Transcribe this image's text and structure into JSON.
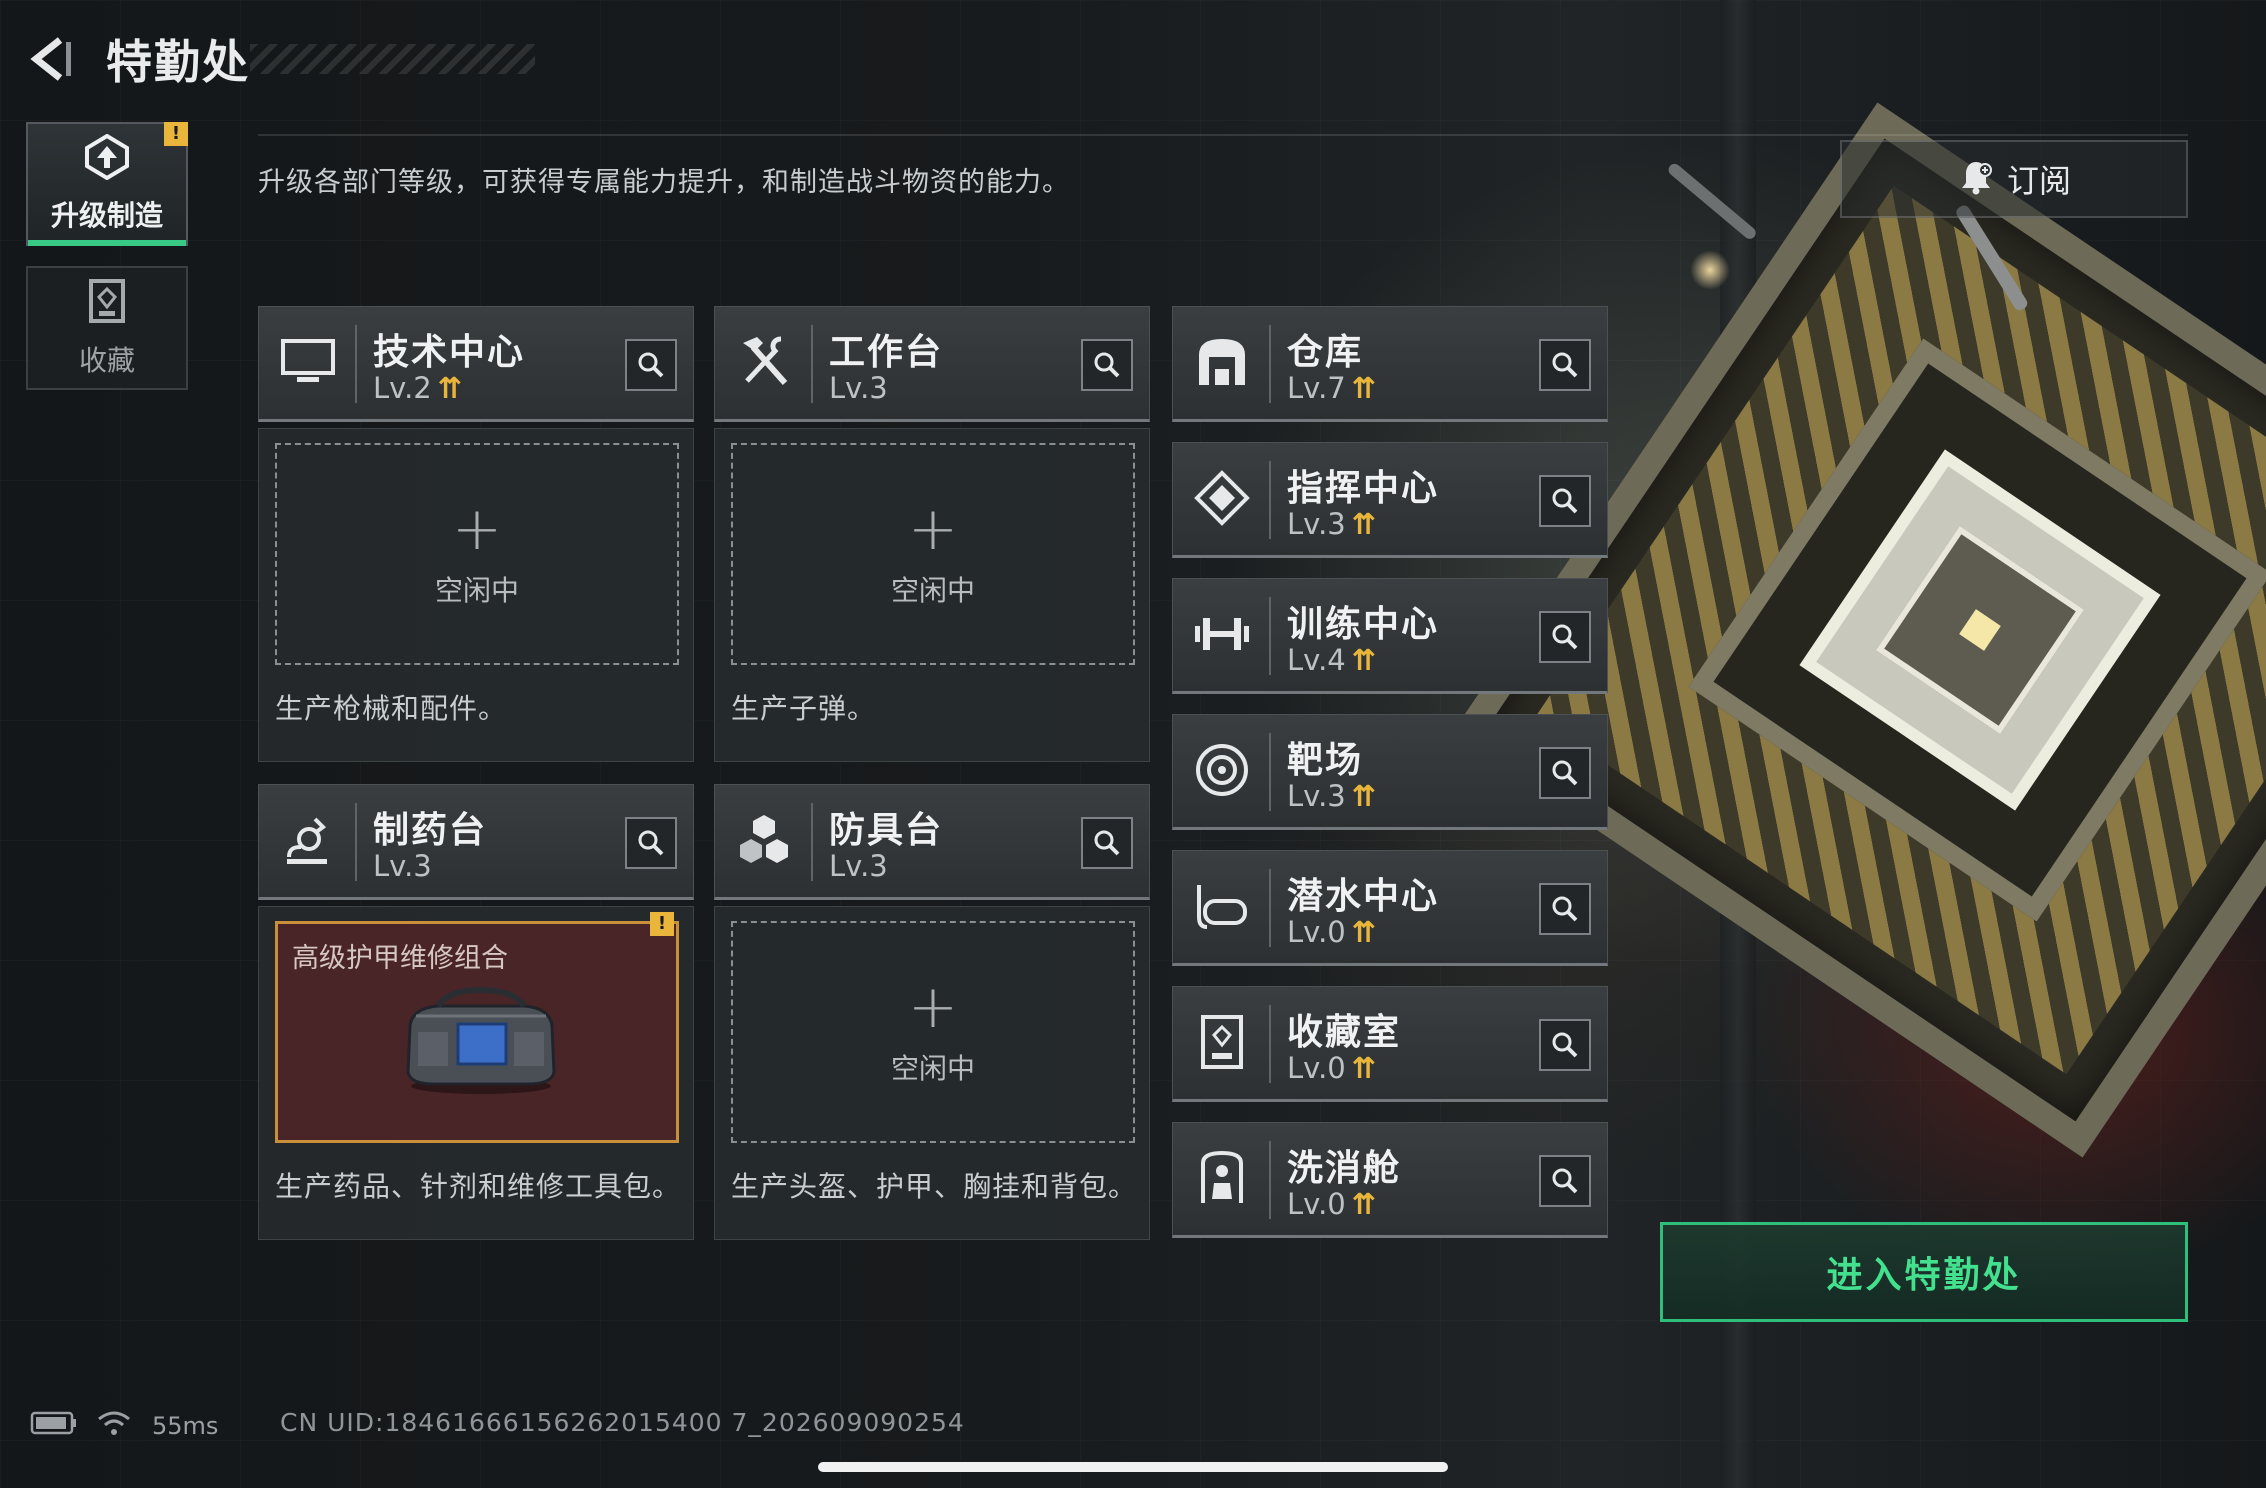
{
  "header": {
    "title": "特勤处",
    "back_icon": "back-arrow-icon"
  },
  "sidebar": {
    "tabs": [
      {
        "label": "升级制造",
        "icon": "upgrade-icon",
        "active": true,
        "badge": "!"
      },
      {
        "label": "收藏",
        "icon": "collection-icon",
        "active": false
      }
    ]
  },
  "main": {
    "subtitle": "升级各部门等级，可获得专属能力提升，和制造战斗物资的能力。",
    "subscribe_label": "订阅",
    "slot_idle_plus": "+",
    "slot_idle_label": "空闲中",
    "workshops": [
      {
        "name": "技术中心",
        "level": "Lv.2",
        "upgradable": true,
        "icon": "monitor-icon",
        "description": "生产枪械和配件。",
        "slot": "idle"
      },
      {
        "name": "工作台",
        "level": "Lv.3",
        "upgradable": false,
        "icon": "hammer-wrench-icon",
        "description": "生产子弹。",
        "slot": "idle"
      },
      {
        "name": "制药台",
        "level": "Lv.3",
        "upgradable": false,
        "icon": "microscope-icon",
        "description": "生产药品、针剂和维修工具包。",
        "slot": "item",
        "item_name": "高级护甲维修组合",
        "item_badge": "!"
      },
      {
        "name": "防具台",
        "level": "Lv.3",
        "upgradable": false,
        "icon": "armor-blocks-icon",
        "description": "生产头盔、护甲、胸挂和背包。",
        "slot": "idle"
      }
    ],
    "facilities": [
      {
        "name": "仓库",
        "level": "Lv.7",
        "upgradable": true,
        "icon": "warehouse-icon"
      },
      {
        "name": "指挥中心",
        "level": "Lv.3",
        "upgradable": true,
        "icon": "command-chip-icon"
      },
      {
        "name": "训练中心",
        "level": "Lv.4",
        "upgradable": true,
        "icon": "dumbbell-icon"
      },
      {
        "name": "靶场",
        "level": "Lv.3",
        "upgradable": true,
        "icon": "target-icon"
      },
      {
        "name": "潜水中心",
        "level": "Lv.0",
        "upgradable": true,
        "icon": "diving-mask-icon"
      },
      {
        "name": "收藏室",
        "level": "Lv.0",
        "upgradable": true,
        "icon": "display-case-icon"
      },
      {
        "name": "洗消舱",
        "level": "Lv.0",
        "upgradable": true,
        "icon": "decon-chamber-icon"
      }
    ],
    "upgrade_glyph": "≈",
    "enter_button": "进入特勤处"
  },
  "status_bar": {
    "ping": "55ms",
    "uid": "CN UID:18461666156262015400 7_202609090254"
  },
  "colors": {
    "accent_green": "#43e08e",
    "upgrade_gold": "#e9b63b",
    "item_border": "#c98f3a",
    "item_bg": "#4a2528"
  }
}
